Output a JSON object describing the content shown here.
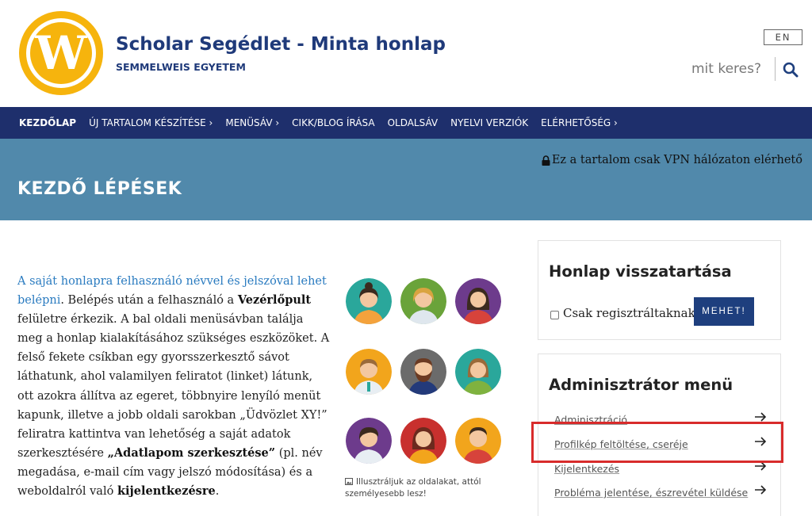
{
  "header": {
    "logo_letter": "W",
    "title": "Scholar Segédlet - Minta honlap",
    "subtitle": "SEMMELWEIS EGYETEM",
    "lang_button": "EN",
    "search_placeholder": "mit keres?"
  },
  "nav": {
    "items": [
      {
        "label": "KEZDŐLAP",
        "active": true
      },
      {
        "label": "ÚJ TARTALOM KÉSZÍTÉSE ›"
      },
      {
        "label": "MENÜSÁV ›"
      },
      {
        "label": "CIKK/BLOG ÍRÁSA"
      },
      {
        "label": "OLDALSÁV"
      },
      {
        "label": "NYELVI VERZIÓK"
      },
      {
        "label": "ELÉRHETŐSÉG ›"
      }
    ]
  },
  "banner": {
    "vpn_notice": "Ez a tartalom csak VPN hálózaton elérhető",
    "page_title": "KEZDŐ LÉPÉSEK"
  },
  "content": {
    "link_text": "A saját honlapra felhasználó névvel és jelszóval lehet belépni",
    "p1": ". Belépés után a felhasználó a ",
    "bold1": "Vezérlőpult",
    "p2": " felületre érkezik. A bal oldali menüsávban találja meg a honlap kialakításához szükséges eszközöket. A felső fekete csíkban egy gyorsszerkesztő sávot láthatunk, ahol valamilyen feliratot (linket) látunk, ott azokra állítva az egeret, többnyire lenyíló menüt kapunk, illetve a jobb oldali sarokban „Üdvözlet XY!” feliratra kattintva van lehetőség a saját adatok szerkesztésére ",
    "bold2": "„Adatlapom szerkesztése”",
    "p3": " (pl. név megadása, e-mail cím vagy jelszó módosítása) és a weboldalról való ",
    "bold3": "kijelentkezésre",
    "p4": ".",
    "image_caption": "Illusztráljuk az oldalakat, attól személyesebb lesz!"
  },
  "sidebar": {
    "widget1": {
      "title": "Honlap visszatartása",
      "checkbox_label": "Csak regisztráltaknak",
      "checkbox_checked": false,
      "button": "MEHET!"
    },
    "widget2": {
      "title": "Adminisztrátor menü",
      "items": [
        {
          "label": "Adminisztráció"
        },
        {
          "label": "Profilkép feltöltése, cseréje",
          "highlighted": true
        },
        {
          "label": "Kijelentkezés"
        },
        {
          "label": "Probléma jelentése, észrevétel küldése"
        }
      ]
    }
  },
  "colors": {
    "nav_bg": "#1e2f6c",
    "banner_bg": "#5189ab",
    "title_blue": "#1f3a7a",
    "logo_yellow": "#f6b40d",
    "highlight_red": "#d82b2b",
    "button_bg": "#1e3f7e"
  },
  "avatars": [
    {
      "icon": "woman-avatar-icon",
      "bg": "#2aa79b"
    },
    {
      "icon": "woman-avatar-icon",
      "bg": "#6aa33a"
    },
    {
      "icon": "woman-avatar-icon",
      "bg": "#6d3b8c"
    },
    {
      "icon": "man-avatar-icon",
      "bg": "#f2a51c"
    },
    {
      "icon": "bearded-man-avatar-icon",
      "bg": "#6b6b6b"
    },
    {
      "icon": "woman-avatar-icon",
      "bg": "#2aa79b"
    },
    {
      "icon": "woman-avatar-icon",
      "bg": "#6d3b8c"
    },
    {
      "icon": "woman-avatar-icon",
      "bg": "#c8302e"
    },
    {
      "icon": "man-avatar-icon",
      "bg": "#f2a51c"
    }
  ]
}
